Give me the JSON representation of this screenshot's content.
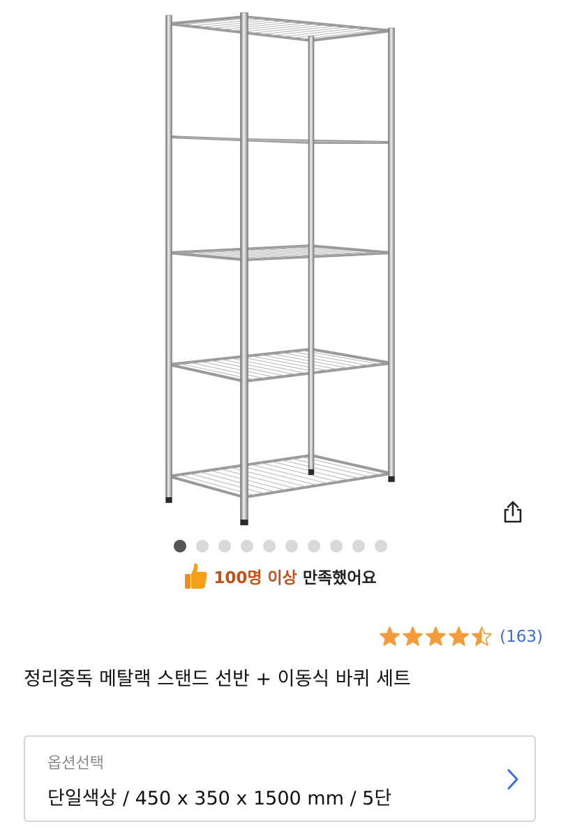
{
  "gallery": {
    "image_alt": "metal rack product image",
    "dots_total": 10,
    "active_index": 0
  },
  "share": {
    "icon": "share-icon"
  },
  "satisfaction": {
    "icon": "thumbs-up-icon",
    "strong_text": "100명 이상",
    "rest_text": "만족했어요"
  },
  "rating": {
    "stars": 4.5,
    "count_text": "(163)",
    "star_color": "#f39c3c"
  },
  "product": {
    "title": "정리중독 메탈랙 스탠드 선반 + 이동식 바퀴 세트"
  },
  "option": {
    "label": "옵션선택",
    "value": "단일색상 / 450 x 350 x 1500 mm / 5단",
    "icon": "chevron-right-icon"
  },
  "colors": {
    "accent_link": "#3a6fd8",
    "satisfaction_accent": "#c0531b",
    "dot_active": "#555555",
    "dot_inactive": "#d9d9d9"
  }
}
